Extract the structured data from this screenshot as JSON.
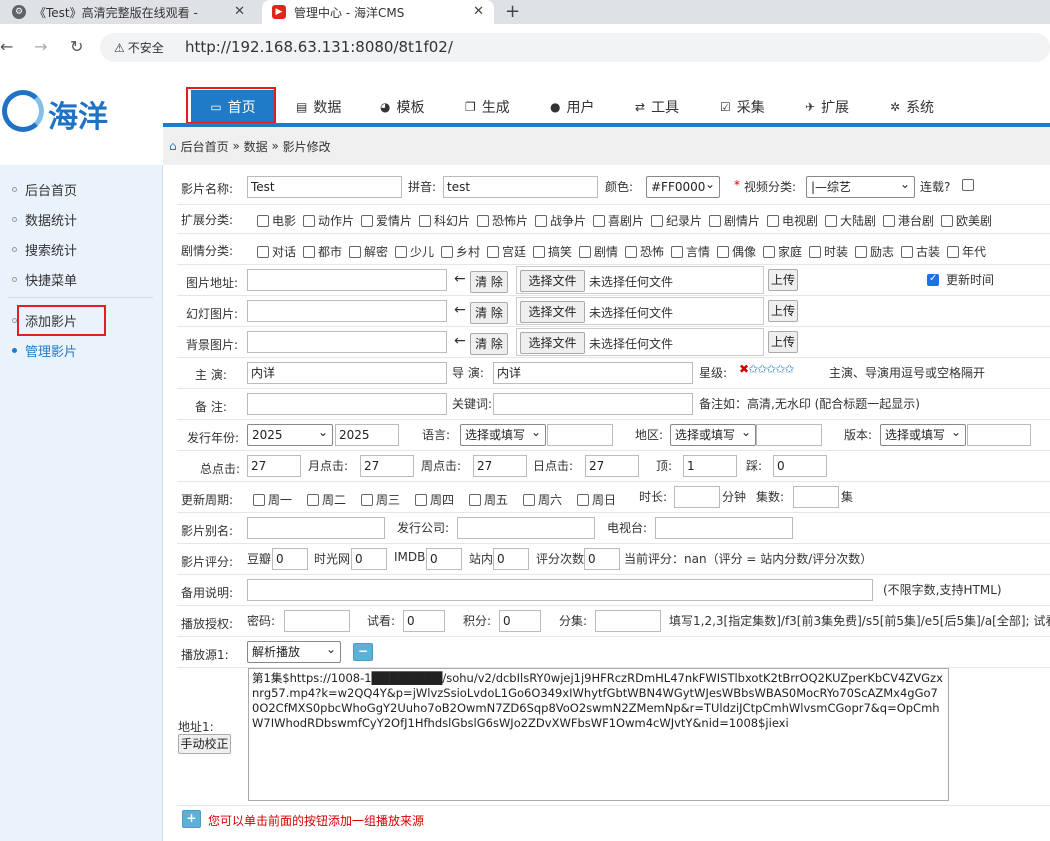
{
  "browser": {
    "tab1": {
      "title": "《Test》高清完整版在线观看 -"
    },
    "tab2": {
      "title": "管理中心 - 海洋CMS"
    },
    "security_label": "不安全",
    "url": "http://192.168.63.131:8080/8t1f02/"
  },
  "logo": {
    "text": "海洋"
  },
  "topnav": [
    {
      "label": "首页",
      "icon": "monitor-icon"
    },
    {
      "label": "数据",
      "icon": "database-icon"
    },
    {
      "label": "模板",
      "icon": "palette-icon"
    },
    {
      "label": "生成",
      "icon": "copy-icon"
    },
    {
      "label": "用户",
      "icon": "user-icon"
    },
    {
      "label": "工具",
      "icon": "tools-icon"
    },
    {
      "label": "采集",
      "icon": "checkbox-icon"
    },
    {
      "label": "扩展",
      "icon": "rocket-icon"
    },
    {
      "label": "系统",
      "icon": "gear-icon"
    }
  ],
  "breadcrumb": {
    "home": "后台首页",
    "sep": "»",
    "data": "数据",
    "current": "影片修改"
  },
  "sidebar": [
    {
      "label": "后台首页"
    },
    {
      "label": "数据统计"
    },
    {
      "label": "搜索统计"
    },
    {
      "label": "快捷菜单"
    },
    {
      "label": "添加影片"
    },
    {
      "label": "管理影片"
    }
  ],
  "form": {
    "name_label": "影片名称:",
    "name_value": "Test",
    "pinyin_label": "拼音:",
    "pinyin_value": "test",
    "color_label": "颜色:",
    "color_value": "#FF0000",
    "category_required": "*",
    "category_label": "视频分类:",
    "category_value": "|—综艺",
    "serial_label": "连载?",
    "ext_label": "扩展分类:",
    "ext_items": [
      "电影",
      "动作片",
      "爱情片",
      "科幻片",
      "恐怖片",
      "战争片",
      "喜剧片",
      "纪录片",
      "剧情片",
      "电视剧",
      "大陆剧",
      "港台剧",
      "欧美剧"
    ],
    "plot_label": "剧情分类:",
    "plot_items": [
      "对话",
      "都市",
      "解密",
      "少儿",
      "乡村",
      "宫廷",
      "搞笑",
      "剧情",
      "恐怖",
      "言情",
      "偶像",
      "家庭",
      "时装",
      "励志",
      "古装",
      "年代"
    ],
    "pic_label": "图片地址:",
    "slide_label": "幻灯图片:",
    "bg_label": "背景图片:",
    "arrow": "←",
    "clear_label": "清 除",
    "choose_file": "选择文件",
    "no_file": "未选择任何文件",
    "upload": "上传",
    "update_time_label": "更新时间",
    "actor_label": "主 演:",
    "actor_value": "内详",
    "director_label": "导 演:",
    "director_value": "内详",
    "stars_label": "星级:",
    "stars_help": "主演、导演用逗号或空格隔开",
    "note_label": "备 注:",
    "keyword_label": "关键词:",
    "note_help": "备注如：高清,无水印 (配合标题一起显示)",
    "year_label": "发行年份:",
    "year_select": "2025",
    "year_value": "2025",
    "lang_label": "语言:",
    "lang_select": "选择或填写",
    "area_label": "地区:",
    "area_select": "选择或填写",
    "version_label": "版本:",
    "version_select": "选择或填写",
    "total_label": "总点击:",
    "total_value": "27",
    "month_label": "月点击:",
    "month_value": "27",
    "week_label": "周点击:",
    "week_value": "27",
    "day_label": "日点击:",
    "day_value": "27",
    "up_label": "顶:",
    "up_value": "1",
    "down_label": "踩:",
    "down_value": "0",
    "cycle_label": "更新周期:",
    "cycle_items": [
      "周一",
      "周二",
      "周三",
      "周四",
      "周五",
      "周六",
      "周日"
    ],
    "duration_label": "时长:",
    "duration_unit": "分钟",
    "episodes_label": "集数:",
    "episodes_unit": "集",
    "alias_label": "影片别名:",
    "publisher_label": "发行公司:",
    "tv_label": "电视台:",
    "rating_label": "影片评分:",
    "douban_label": "豆瓣",
    "douban_value": "0",
    "mtime_label": "时光网",
    "mtime_value": "0",
    "imdb_label": "IMDB",
    "imdb_value": "0",
    "site_label": "站内",
    "site_value": "0",
    "votes_label": "评分次数",
    "votes_value": "0",
    "current_score": "当前评分：nan（评分 = 站内分数/评分次数）",
    "backup_label": "备用说明:",
    "backup_help": "(不限字数,支持HTML)",
    "auth_label": "播放授权:",
    "pwd_label": "密码:",
    "trial_label": "试看:",
    "trial_value": "0",
    "points_label": "积分:",
    "points_value": "0",
    "episode_label": "分集:",
    "auth_help": "填写1,2,3[指定集数]/f3[前3集免费]/s5[前5集]/e5[后5集]/a[全部]; 试看",
    "source_label": "播放源1:",
    "source_select": "解析播放",
    "minus": "−",
    "addr_label": "地址1:",
    "fix_button": "手动校正",
    "addr_value": "第1集$https://1008-1████████/sohu/v2/dcbIlsRY0wjej1j9HFRczRDmHL47nkFWISTlbxotK2tBrrOQ2KUZperKbCV4ZVGzxnrg57.mp4?k=w2QQ4Y&p=jWlvzSsioLvdoL1Go6O349xIWhytfGbtWBN4WGytWJesWBbsWBAS0MocRYo70ScAZMx4gGo70O2CfMXS0pbcWhoGgY2Uuho7oB2OwmN7ZD6Sqp8VoO2swmN2ZMemNp&r=TUldziJCtpCmhWlvsmCGopr7&q=OpCmhW7IWhodRDbswmfCyY2OfJ1HfhdslGbslG6sWJo2ZDvXWFbsWF1Owm4cWJvtY&nid=1008$jiexi",
    "add_hint": "您可以单击前面的按钮添加一组播放来源",
    "plus": "+"
  }
}
